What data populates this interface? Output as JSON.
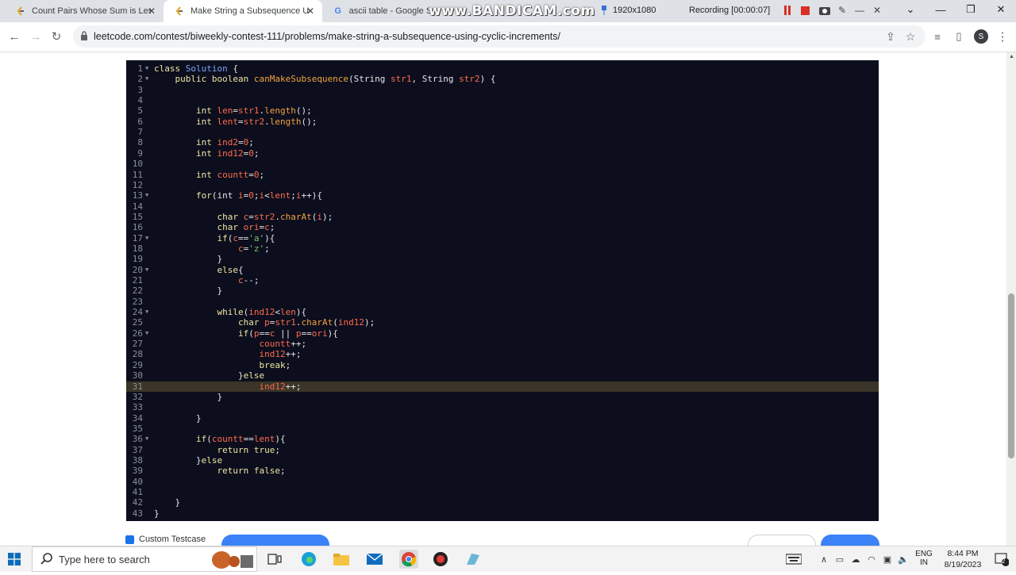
{
  "browser": {
    "tabs": [
      {
        "title": "Count Pairs Whose Sum is Less th",
        "favicon": "leetcode-icon",
        "active": false
      },
      {
        "title": "Make String a Subsequence Usin",
        "favicon": "leetcode-icon",
        "active": true
      },
      {
        "title": "ascii table - Google Sea",
        "favicon": "google-icon",
        "active": false
      }
    ],
    "url": "leetcode.com/contest/biweekly-contest-111/problems/make-string-a-subsequence-using-cyclic-increments/",
    "profile_initial": "S"
  },
  "recorder": {
    "logo": "www.BANDICAM.com",
    "resolution": "1920x1080",
    "status": "Recording [00:00:07]"
  },
  "editor": {
    "active_line": 31,
    "lines": [
      {
        "n": "1",
        "fold": true,
        "t": [
          [
            "kw",
            "class "
          ],
          [
            "cls",
            "Solution"
          ],
          [
            "op",
            " {"
          ]
        ]
      },
      {
        "n": "2",
        "fold": true,
        "t": [
          [
            "op",
            "    "
          ],
          [
            "kw",
            "public boolean "
          ],
          [
            "fn",
            "canMakeSubsequence"
          ],
          [
            "op",
            "(String "
          ],
          [
            "var",
            "str1"
          ],
          [
            "op",
            ", String "
          ],
          [
            "var",
            "str2"
          ],
          [
            "op",
            ") {"
          ]
        ]
      },
      {
        "n": "3",
        "fold": false,
        "t": []
      },
      {
        "n": "4",
        "fold": false,
        "t": []
      },
      {
        "n": "5",
        "fold": false,
        "t": [
          [
            "op",
            "        "
          ],
          [
            "kw",
            "int "
          ],
          [
            "var",
            "len"
          ],
          [
            "op",
            "="
          ],
          [
            "var",
            "str1"
          ],
          [
            "op",
            "."
          ],
          [
            "fn",
            "length"
          ],
          [
            "op",
            "();"
          ]
        ]
      },
      {
        "n": "6",
        "fold": false,
        "t": [
          [
            "op",
            "        "
          ],
          [
            "kw",
            "int "
          ],
          [
            "var",
            "lent"
          ],
          [
            "op",
            "="
          ],
          [
            "var",
            "str2"
          ],
          [
            "op",
            "."
          ],
          [
            "fn",
            "length"
          ],
          [
            "op",
            "();"
          ]
        ]
      },
      {
        "n": "7",
        "fold": false,
        "t": []
      },
      {
        "n": "8",
        "fold": false,
        "t": [
          [
            "op",
            "        "
          ],
          [
            "kw",
            "int "
          ],
          [
            "var",
            "ind2"
          ],
          [
            "op",
            "="
          ],
          [
            "num",
            "0"
          ],
          [
            "op",
            ";"
          ]
        ]
      },
      {
        "n": "9",
        "fold": false,
        "t": [
          [
            "op",
            "        "
          ],
          [
            "kw",
            "int "
          ],
          [
            "var",
            "ind12"
          ],
          [
            "op",
            "="
          ],
          [
            "num",
            "0"
          ],
          [
            "op",
            ";"
          ]
        ]
      },
      {
        "n": "10",
        "fold": false,
        "t": []
      },
      {
        "n": "11",
        "fold": false,
        "t": [
          [
            "op",
            "        "
          ],
          [
            "kw",
            "int "
          ],
          [
            "var",
            "countt"
          ],
          [
            "op",
            "="
          ],
          [
            "num",
            "0"
          ],
          [
            "op",
            ";"
          ]
        ]
      },
      {
        "n": "12",
        "fold": false,
        "t": []
      },
      {
        "n": "13",
        "fold": true,
        "t": [
          [
            "op",
            "        "
          ],
          [
            "kw",
            "for"
          ],
          [
            "op",
            "(int "
          ],
          [
            "var",
            "i"
          ],
          [
            "op",
            "="
          ],
          [
            "num",
            "0"
          ],
          [
            "op",
            ";"
          ],
          [
            "var",
            "i"
          ],
          [
            "op",
            "<"
          ],
          [
            "var",
            "lent"
          ],
          [
            "op",
            ";"
          ],
          [
            "var",
            "i"
          ],
          [
            "op",
            "++){"
          ]
        ]
      },
      {
        "n": "14",
        "fold": false,
        "t": []
      },
      {
        "n": "15",
        "fold": false,
        "t": [
          [
            "op",
            "            "
          ],
          [
            "kw",
            "char "
          ],
          [
            "var",
            "c"
          ],
          [
            "op",
            "="
          ],
          [
            "var",
            "str2"
          ],
          [
            "op",
            "."
          ],
          [
            "fn",
            "charAt"
          ],
          [
            "op",
            "("
          ],
          [
            "var",
            "i"
          ],
          [
            "op",
            ");"
          ]
        ]
      },
      {
        "n": "16",
        "fold": false,
        "t": [
          [
            "op",
            "            "
          ],
          [
            "kw",
            "char "
          ],
          [
            "var",
            "ori"
          ],
          [
            "op",
            "="
          ],
          [
            "var",
            "c"
          ],
          [
            "op",
            ";"
          ]
        ]
      },
      {
        "n": "17",
        "fold": true,
        "t": [
          [
            "op",
            "            "
          ],
          [
            "kw",
            "if"
          ],
          [
            "op",
            "("
          ],
          [
            "var",
            "c"
          ],
          [
            "op",
            "=="
          ],
          [
            "str",
            "'a'"
          ],
          [
            "op",
            "){"
          ]
        ]
      },
      {
        "n": "18",
        "fold": false,
        "t": [
          [
            "op",
            "                "
          ],
          [
            "var",
            "c"
          ],
          [
            "op",
            "="
          ],
          [
            "str",
            "'z'"
          ],
          [
            "op",
            ";"
          ]
        ]
      },
      {
        "n": "19",
        "fold": false,
        "t": [
          [
            "op",
            "            }"
          ]
        ]
      },
      {
        "n": "20",
        "fold": true,
        "t": [
          [
            "op",
            "            "
          ],
          [
            "kw",
            "else"
          ],
          [
            "op",
            "{"
          ]
        ]
      },
      {
        "n": "21",
        "fold": false,
        "t": [
          [
            "op",
            "                "
          ],
          [
            "var",
            "c"
          ],
          [
            "op",
            "--;"
          ]
        ]
      },
      {
        "n": "22",
        "fold": false,
        "t": [
          [
            "op",
            "            }"
          ]
        ]
      },
      {
        "n": "23",
        "fold": false,
        "t": []
      },
      {
        "n": "24",
        "fold": true,
        "t": [
          [
            "op",
            "            "
          ],
          [
            "kw",
            "while"
          ],
          [
            "op",
            "("
          ],
          [
            "var",
            "ind12"
          ],
          [
            "op",
            "<"
          ],
          [
            "var",
            "len"
          ],
          [
            "op",
            "){"
          ]
        ]
      },
      {
        "n": "25",
        "fold": false,
        "t": [
          [
            "op",
            "                "
          ],
          [
            "kw",
            "char "
          ],
          [
            "var",
            "p"
          ],
          [
            "op",
            "="
          ],
          [
            "var",
            "str1"
          ],
          [
            "op",
            "."
          ],
          [
            "fn",
            "charAt"
          ],
          [
            "op",
            "("
          ],
          [
            "var",
            "ind12"
          ],
          [
            "op",
            ");"
          ]
        ]
      },
      {
        "n": "26",
        "fold": true,
        "t": [
          [
            "op",
            "                "
          ],
          [
            "kw",
            "if"
          ],
          [
            "op",
            "("
          ],
          [
            "var",
            "p"
          ],
          [
            "op",
            "=="
          ],
          [
            "var",
            "c"
          ],
          [
            "op",
            " || "
          ],
          [
            "var",
            "p"
          ],
          [
            "op",
            "=="
          ],
          [
            "var",
            "ori"
          ],
          [
            "op",
            "){"
          ]
        ]
      },
      {
        "n": "27",
        "fold": false,
        "t": [
          [
            "op",
            "                    "
          ],
          [
            "var",
            "countt"
          ],
          [
            "op",
            "++;"
          ]
        ]
      },
      {
        "n": "28",
        "fold": false,
        "t": [
          [
            "op",
            "                    "
          ],
          [
            "var",
            "ind12"
          ],
          [
            "op",
            "++;"
          ]
        ]
      },
      {
        "n": "29",
        "fold": false,
        "t": [
          [
            "op",
            "                    "
          ],
          [
            "kw",
            "break"
          ],
          [
            "op",
            ";"
          ]
        ]
      },
      {
        "n": "30",
        "fold": false,
        "t": [
          [
            "op",
            "                }"
          ],
          [
            "kw",
            "else"
          ]
        ]
      },
      {
        "n": "31",
        "fold": false,
        "t": [
          [
            "op",
            "                    "
          ],
          [
            "var",
            "ind12"
          ],
          [
            "op",
            "++;"
          ]
        ]
      },
      {
        "n": "32",
        "fold": false,
        "t": [
          [
            "op",
            "            }"
          ]
        ]
      },
      {
        "n": "33",
        "fold": false,
        "t": []
      },
      {
        "n": "34",
        "fold": false,
        "t": [
          [
            "op",
            "        }"
          ]
        ]
      },
      {
        "n": "35",
        "fold": false,
        "t": []
      },
      {
        "n": "36",
        "fold": true,
        "t": [
          [
            "op",
            "        "
          ],
          [
            "kw",
            "if"
          ],
          [
            "op",
            "("
          ],
          [
            "var",
            "countt"
          ],
          [
            "op",
            "=="
          ],
          [
            "var",
            "lent"
          ],
          [
            "op",
            "){"
          ]
        ]
      },
      {
        "n": "37",
        "fold": false,
        "t": [
          [
            "op",
            "            "
          ],
          [
            "kw",
            "return true"
          ],
          [
            "op",
            ";"
          ]
        ]
      },
      {
        "n": "38",
        "fold": false,
        "t": [
          [
            "op",
            "        }"
          ],
          [
            "kw",
            "else"
          ]
        ]
      },
      {
        "n": "39",
        "fold": false,
        "t": [
          [
            "op",
            "            "
          ],
          [
            "kw",
            "return false"
          ],
          [
            "op",
            ";"
          ]
        ]
      },
      {
        "n": "40",
        "fold": false,
        "t": []
      },
      {
        "n": "41",
        "fold": false,
        "t": []
      },
      {
        "n": "42",
        "fold": false,
        "t": [
          [
            "op",
            "    }"
          ]
        ]
      },
      {
        "n": "43",
        "fold": false,
        "t": [
          [
            "op",
            "}"
          ]
        ]
      }
    ]
  },
  "page": {
    "custom_testcase_label": "Custom Testcase"
  },
  "taskbar": {
    "search_placeholder": "Type here to search",
    "lang_top": "ENG",
    "lang_bottom": "IN",
    "time": "8:44 PM",
    "date": "8/19/2023",
    "notification_count": "2"
  },
  "colors": {
    "editor_bg": "#0c0e1e",
    "keyword": "#f0e6a0",
    "class_name": "#7aa2f7",
    "function": "#f2a33c",
    "variable": "#ff6b4a",
    "string": "#7bc36b",
    "active_line": "#3a3528",
    "accent_blue": "#1a73e8"
  }
}
